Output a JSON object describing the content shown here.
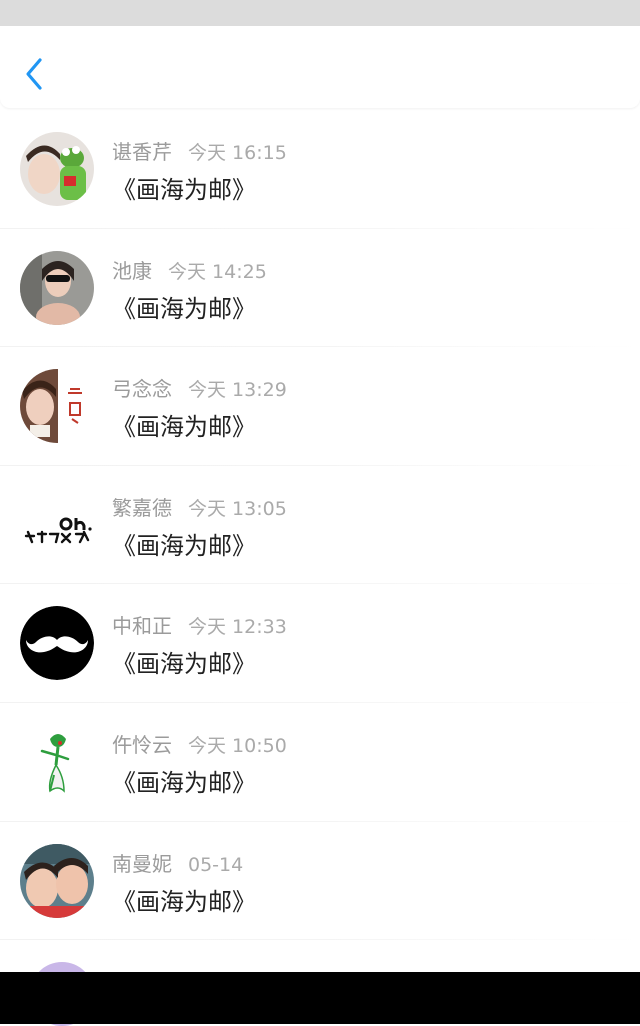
{
  "header": {
    "back_icon": "chevron-left-icon"
  },
  "colors": {
    "accent": "#2196F3",
    "statusbar": "#dcdcdc",
    "name_text": "#9b9b9b",
    "body_text": "#222222"
  },
  "messages": [
    {
      "name": "谌香芹",
      "time": "今天 16:15",
      "text": "《画海为邮》",
      "avatar": "boy-with-green-frog-toy"
    },
    {
      "name": "池康",
      "time": "今天 14:25",
      "text": "《画海为邮》",
      "avatar": "girl-with-sunglasses"
    },
    {
      "name": "弓念念",
      "time": "今天 13:29",
      "text": "《画海为邮》",
      "avatar": "boy-with-red-characters"
    },
    {
      "name": "繁嘉德",
      "time": "今天 13:05",
      "text": "《画海为邮》",
      "avatar": "oh-text-logo"
    },
    {
      "name": "中和正",
      "time": "今天 12:33",
      "text": "《画海为邮》",
      "avatar": "mustache-icon"
    },
    {
      "name": "仵怜云",
      "time": "今天 10:50",
      "text": "《画海为邮》",
      "avatar": "green-fairy-character"
    },
    {
      "name": "南曼妮",
      "time": "05-14",
      "text": "《画海为邮》",
      "avatar": "two-children-photo"
    }
  ]
}
